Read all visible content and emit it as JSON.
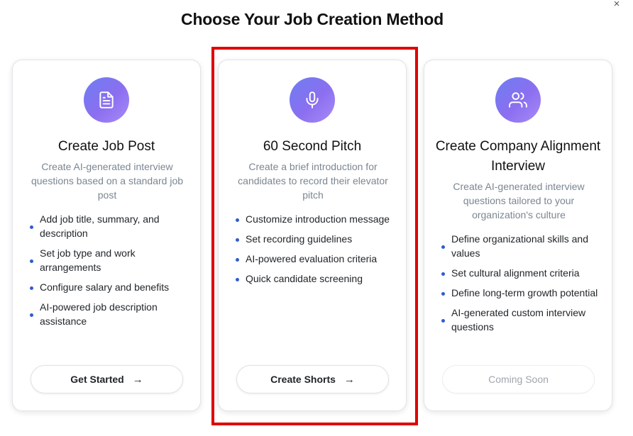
{
  "dialog": {
    "title": "Choose Your Job Creation Method",
    "close_symbol": "×"
  },
  "cards": [
    {
      "icon": "document-icon",
      "title": "Create Job Post",
      "description": "Create AI-generated interview questions based on a standard job post",
      "features": [
        "Add job title, summary, and description",
        "Set job type and work arrangements",
        "Configure salary and benefits",
        "AI-powered job description assistance"
      ],
      "button_label": "Get Started",
      "button_arrow": "→"
    },
    {
      "icon": "microphone-icon",
      "title": "60 Second Pitch",
      "description": "Create a brief introduction for candidates to record their elevator pitch",
      "features": [
        "Customize introduction message",
        "Set recording guidelines",
        "AI-powered evaluation criteria",
        "Quick candidate screening"
      ],
      "button_label": "Create Shorts",
      "button_arrow": "→"
    },
    {
      "icon": "users-icon",
      "title": "Create Company Alignment Interview",
      "description": "Create AI-generated interview questions tailored to your organization's culture",
      "features": [
        "Define organizational skills and values",
        "Set cultural alignment criteria",
        "Define long-term growth potential",
        "AI-generated custom interview questions"
      ],
      "button_label": "Coming Soon",
      "button_disabled": true
    }
  ],
  "colors": {
    "icon_gradient_start": "#6e7df2",
    "icon_gradient_end": "#a98bf7",
    "bullet": "#2f5bd3",
    "description_text": "#7b8691",
    "highlight_border": "#e00000"
  }
}
